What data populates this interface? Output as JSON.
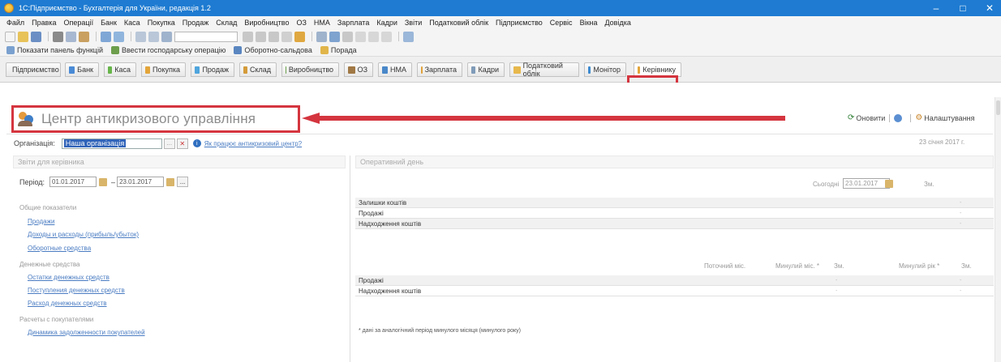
{
  "window": {
    "title": "1С:Підприємство - Бухгалтерія для України, редакція 1.2",
    "controls": {
      "minimize": "–",
      "maximize": "□",
      "close": "✕"
    }
  },
  "menu": [
    "Файл",
    "Правка",
    "Операції",
    "Банк",
    "Каса",
    "Покупка",
    "Продаж",
    "Склад",
    "Виробництво",
    "ОЗ",
    "НМА",
    "Зарплата",
    "Кадри",
    "Звіти",
    "Податковий облік",
    "Підприємство",
    "Сервіс",
    "Вікна",
    "Довідка"
  ],
  "panelbar": {
    "show_panel": "Показати панель функцій",
    "enter_op": "Ввести господарську операцію",
    "turnover": "Оборотно-сальдова",
    "help": "Порада"
  },
  "tabs": [
    {
      "label": "Підприємство",
      "color": "#5aa5e8"
    },
    {
      "label": "Банк",
      "color": "#4a8bd6"
    },
    {
      "label": "Каса",
      "color": "#67b54a"
    },
    {
      "label": "Покупка",
      "color": "#e3a53a"
    },
    {
      "label": "Продаж",
      "color": "#4fa5dd"
    },
    {
      "label": "Склад",
      "color": "#d49b3a"
    },
    {
      "label": "Виробництво",
      "color": "#6aa14e"
    },
    {
      "label": "ОЗ",
      "color": "#a07844"
    },
    {
      "label": "НМА",
      "color": "#4a88c9"
    },
    {
      "label": "Зарплата",
      "color": "#e0a13a"
    },
    {
      "label": "Кадри",
      "color": "#7f9bb8"
    },
    {
      "label": "Податковий облік",
      "color": "#e7b84c"
    },
    {
      "label": "Монітор",
      "color": "#3d8ad0"
    },
    {
      "label": "Керівнику",
      "color": "#e3a53a"
    }
  ],
  "page": {
    "title": "Центр антикризового управління",
    "refresh": "Оновити",
    "settings": "Налаштування",
    "date": "23 січня 2017 г."
  },
  "org": {
    "label": "Організація:",
    "value": "Наша організація",
    "link": "Як працює антикризовий центр?"
  },
  "left": {
    "header": "Звіти для керівника",
    "period_label": "Період:",
    "date_from": "01.01.2017",
    "date_to": "23.01.2017",
    "dots": "...",
    "groups": [
      {
        "title": "Общие показатели",
        "links": [
          "Продажи",
          "Доходы и расходы (прибыль/убыток)",
          "Оборотные средства"
        ]
      },
      {
        "title": "Денежные средства",
        "links": [
          "Остатки денежных средств",
          "Поступления денежных средств",
          "Расход денежных средств"
        ]
      },
      {
        "title": "Расчеты с покупателями",
        "links": [
          "Динамика задолженности покупателей"
        ]
      }
    ]
  },
  "right": {
    "header": "Оперативний день",
    "today_label": "Сьогодні",
    "today_value": "23.01.2017",
    "col_zm": "Зм.",
    "table1": [
      {
        "label": "Залишки коштів",
        "value": "-"
      },
      {
        "label": "Продажі",
        "value": "-"
      },
      {
        "label": "Надходження коштів",
        "value": "-"
      }
    ],
    "cols2": {
      "current_month": "Поточний міс.",
      "prev_month": "Минулий міс. *",
      "zm1": "Зм.",
      "prev_year": "Минулий рік *",
      "zm2": "Зм."
    },
    "table2": [
      {
        "label": "Продажі",
        "value": "-",
        "value2": "-"
      },
      {
        "label": "Надходження коштів",
        "value": "-",
        "value2": "-"
      }
    ],
    "footnote": "* дані за аналогічний період минулого місяця (минулого року)"
  },
  "colors": {
    "titlebar": "#1e7bd1",
    "highlight": "#d4353f",
    "link": "#4a7cc2"
  }
}
